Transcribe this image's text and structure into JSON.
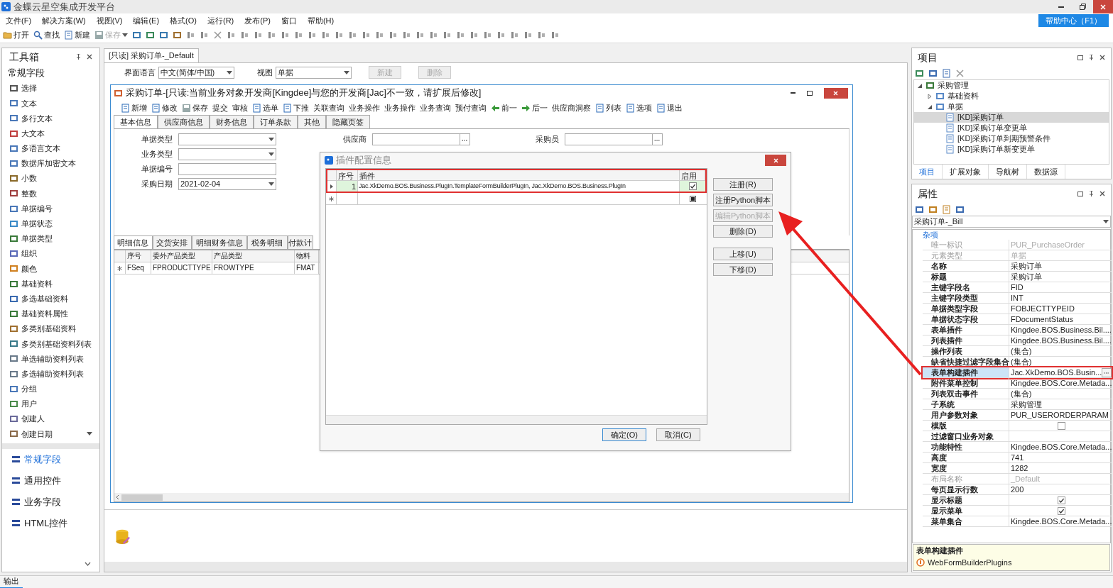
{
  "app_title": "金蝶云星空集成开发平台",
  "menus": [
    "文件(F)",
    "解决方案(W)",
    "视图(V)",
    "编辑(E)",
    "格式(O)",
    "运行(R)",
    "发布(P)",
    "窗口",
    "帮助(H)"
  ],
  "help_button": "帮助中心（F1）",
  "toolbar": [
    {
      "label": "打开",
      "disabled": false
    },
    {
      "label": "查找",
      "disabled": false
    },
    {
      "label": "新建",
      "disabled": false
    },
    {
      "label": "保存",
      "disabled": true
    }
  ],
  "toolbox": {
    "title": "工具箱",
    "section": "常规字段",
    "items": [
      "选择",
      "文本",
      "多行文本",
      "大文本",
      "多语言文本",
      "数据库加密文本",
      "小数",
      "整数",
      "单据编号",
      "单据状态",
      "单据类型",
      "组织",
      "颜色",
      "基础资料",
      "多选基础资料",
      "基础资料属性",
      "多类别基础资料",
      "多类别基础资料列表",
      "单选辅助资料列表",
      "多选辅助资料列表",
      "分组",
      "用户",
      "创建人",
      "创建日期"
    ],
    "categories": [
      {
        "label": "常规字段",
        "selected": true
      },
      {
        "label": "通用控件",
        "selected": false
      },
      {
        "label": "业务字段",
        "selected": false
      },
      {
        "label": "HTML控件",
        "selected": false
      }
    ]
  },
  "document_tab": {
    "label": "[只读] 采购订单-_Default",
    "selected": true
  },
  "form_settings": {
    "language_label": "界面语言",
    "language": "中文(简体/中国)",
    "view_label": "视图",
    "view": "单据",
    "buttons": [
      {
        "label": "新建",
        "disabled": true
      },
      {
        "label": "删除",
        "disabled": true
      }
    ]
  },
  "form_window": {
    "title": "采购订单-[只读:当前业务对象开发商[Kingdee]与您的开发商[Jac]不一致，请扩展后修改]",
    "toolbar": [
      {
        "label": "新增",
        "icon": true
      },
      {
        "label": "修改",
        "icon": true
      },
      {
        "label": "保存",
        "icon": true
      },
      {
        "label": "提交",
        "icon": false
      },
      {
        "label": "审核",
        "icon": false
      },
      {
        "label": "选单",
        "icon": true
      },
      {
        "label": "下推",
        "icon": true
      },
      {
        "label": "关联查询",
        "icon": false
      },
      {
        "label": "业务操作",
        "icon": false
      },
      {
        "label": "业务操作",
        "icon": false
      },
      {
        "label": "业务查询",
        "icon": false
      },
      {
        "label": "预付查询",
        "icon": false
      },
      {
        "label": "前一",
        "icon": true
      },
      {
        "label": "后一",
        "icon": true
      },
      {
        "label": "供应商洞察",
        "icon": false
      },
      {
        "label": "列表",
        "icon": true
      },
      {
        "label": "选项",
        "icon": true
      },
      {
        "label": "退出",
        "icon": true
      }
    ],
    "tabs": [
      {
        "label": "基本信息",
        "selected": true
      },
      {
        "label": "供应商信息",
        "selected": false
      },
      {
        "label": "财务信息",
        "selected": false
      },
      {
        "label": "订单条款",
        "selected": false
      },
      {
        "label": "其他",
        "selected": false
      },
      {
        "label": "隐藏页签",
        "selected": false
      }
    ],
    "fields": [
      {
        "label": "单据类型",
        "kind": "select"
      },
      {
        "label": "业务类型",
        "kind": "select"
      },
      {
        "label": "单据编号",
        "kind": "text"
      },
      {
        "label": "采购日期",
        "kind": "select",
        "value": "2021-02-04"
      }
    ],
    "lookups": [
      {
        "label": "供应商"
      },
      {
        "label": "采购员"
      }
    ],
    "detail_tabs": [
      {
        "label": "明细信息",
        "selected": true
      },
      {
        "label": "交货安排",
        "selected": false
      },
      {
        "label": "明细财务信息",
        "selected": false
      },
      {
        "label": "税务明细",
        "selected": false
      },
      {
        "label": "付款计",
        "selected": false
      }
    ],
    "grid": {
      "columns": [
        "序号",
        "委外产品类型",
        "产品类型",
        "物料"
      ],
      "new_row": [
        "FSeq",
        "FPRODUCTTYPE",
        "FROWTYPE",
        "FMAT"
      ]
    }
  },
  "dialog": {
    "title": "插件配置信息",
    "columns": [
      "序号",
      "插件",
      "启用"
    ],
    "rows": [
      {
        "index": "1",
        "plugin": "Jac.XkDemo.BOS.Business.PlugIn.TemplateFormBuilderPlugIn, Jac.XkDemo.BOS.Business.PlugIn",
        "enabled": true,
        "selected": true
      }
    ],
    "new_row": {
      "indeterminate": true
    },
    "side_buttons": [
      {
        "label": "注册(R)",
        "disabled": false
      },
      {
        "label": "注册Python脚本",
        "disabled": false
      },
      {
        "label": "编辑Python脚本",
        "disabled": true
      },
      {
        "label": "删除(D)",
        "disabled": false
      },
      {
        "label": "上移(U)",
        "disabled": false
      },
      {
        "label": "下移(D)",
        "disabled": false
      }
    ],
    "buttons": [
      {
        "label": "确定(O)",
        "default": true
      },
      {
        "label": "取消(C)",
        "default": false
      }
    ]
  },
  "project_panel": {
    "title": "项目",
    "tree": [
      {
        "label": "采购管理",
        "expanded": true,
        "selected": false,
        "children": [
          {
            "label": "基础资料",
            "expanded": false,
            "selected": false
          },
          {
            "label": "单据",
            "expanded": true,
            "selected": false,
            "children": [
              {
                "label": "[KD]采购订单",
                "selected": true
              },
              {
                "label": "[KD]采购订单变更单",
                "selected": false
              },
              {
                "label": "[KD]采购订单到期预警条件",
                "selected": false
              },
              {
                "label": "[KD]采购订单新变更单",
                "selected": false
              }
            ]
          }
        ]
      }
    ],
    "tabs": [
      {
        "label": "项目",
        "selected": true
      },
      {
        "label": "扩展对象",
        "selected": false
      },
      {
        "label": "导航树",
        "selected": false
      },
      {
        "label": "数据源",
        "selected": false
      }
    ]
  },
  "properties_panel": {
    "title": "属性",
    "object": "采购订单-_Bill",
    "category": "杂项",
    "rows": [
      {
        "name": "唯一标识",
        "kind": "text",
        "value": "PUR_PurchaseOrder",
        "readonly": true,
        "selected": false
      },
      {
        "name": "元素类型",
        "kind": "text",
        "value": "单据",
        "readonly": true,
        "selected": false
      },
      {
        "name": "名称",
        "kind": "text",
        "value": "采购订单",
        "readonly": false,
        "selected": false
      },
      {
        "name": "标题",
        "kind": "text",
        "value": "采购订单",
        "readonly": false,
        "selected": false
      },
      {
        "name": "主键字段名",
        "kind": "text",
        "value": "FID",
        "readonly": false,
        "selected": false
      },
      {
        "name": "主键字段类型",
        "kind": "text",
        "value": "INT",
        "readonly": false,
        "selected": false
      },
      {
        "name": "单据类型字段",
        "kind": "text",
        "value": "FOBJECTTYPEID",
        "readonly": false,
        "selected": false
      },
      {
        "name": "单据状态字段",
        "kind": "text",
        "value": "FDocumentStatus",
        "readonly": false,
        "selected": false
      },
      {
        "name": "表单插件",
        "kind": "text",
        "value": "Kingdee.BOS.Business.Bil....",
        "readonly": false,
        "selected": false
      },
      {
        "name": "列表插件",
        "kind": "text",
        "value": "Kingdee.BOS.Business.Bil....",
        "readonly": false,
        "selected": false
      },
      {
        "name": "操作列表",
        "kind": "text",
        "value": "(集合)",
        "readonly": false,
        "selected": false
      },
      {
        "name": "缺省快捷过滤字段集合",
        "kind": "text",
        "value": "(集合)",
        "readonly": false,
        "selected": false
      },
      {
        "name": "表单构建插件",
        "kind": "text",
        "value": "Jac.XkDemo.BOS.Busin...",
        "readonly": false,
        "selected": true
      },
      {
        "name": "附件菜单控制",
        "kind": "text",
        "value": "Kingdee.BOS.Core.Metada...",
        "readonly": false,
        "selected": false
      },
      {
        "name": "列表双击事件",
        "kind": "text",
        "value": "(集合)",
        "readonly": false,
        "selected": false
      },
      {
        "name": "子系统",
        "kind": "text",
        "value": "采购管理",
        "readonly": false,
        "selected": false
      },
      {
        "name": "用户参数对象",
        "kind": "text",
        "value": "PUR_USERORDERPARAM",
        "readonly": false,
        "selected": false
      },
      {
        "name": "模版",
        "kind": "checkbox",
        "checked": false,
        "readonly": false,
        "selected": false
      },
      {
        "name": "过滤窗口业务对象",
        "kind": "text",
        "readonly": false,
        "selected": false
      },
      {
        "name": "功能特性",
        "kind": "text",
        "value": "Kingdee.BOS.Core.Metada...",
        "readonly": false,
        "selected": false
      },
      {
        "name": "高度",
        "kind": "text",
        "value": "741",
        "readonly": false,
        "selected": false
      },
      {
        "name": "宽度",
        "kind": "text",
        "value": "1282",
        "readonly": false,
        "selected": false
      },
      {
        "name": "布局名称",
        "kind": "text",
        "value": "_Default",
        "readonly": true,
        "selected": false
      },
      {
        "name": "每页显示行数",
        "kind": "text",
        "value": "200",
        "readonly": false,
        "selected": false
      },
      {
        "name": "显示标题",
        "kind": "checkbox",
        "checked": true,
        "readonly": false,
        "selected": false
      },
      {
        "name": "显示菜单",
        "kind": "checkbox",
        "checked": true,
        "readonly": false,
        "selected": false
      },
      {
        "name": "菜单集合",
        "kind": "text",
        "value": "Kingdee.BOS.Core.Metada...",
        "readonly": false,
        "selected": false
      }
    ],
    "description": {
      "title": "表单构建插件",
      "value": "WebFormBuilderPlugins"
    }
  },
  "output_label": "输出"
}
